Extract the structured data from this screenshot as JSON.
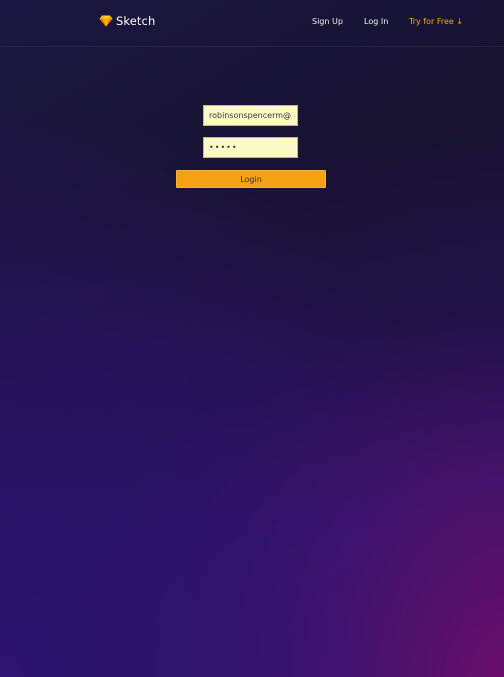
{
  "header": {
    "brand_name": "Sketch",
    "brand_icon": "diamond-icon",
    "nav": {
      "signup_label": "Sign Up",
      "login_label": "Log In",
      "try_label": "Try for Free ↓"
    }
  },
  "form": {
    "email_value": "robinsonspencerm@",
    "password_value": "•••••",
    "submit_label": "Login"
  },
  "colors": {
    "accent": "#f7a71b",
    "button": "#f5a212",
    "input_background": "#fbfbc6"
  }
}
